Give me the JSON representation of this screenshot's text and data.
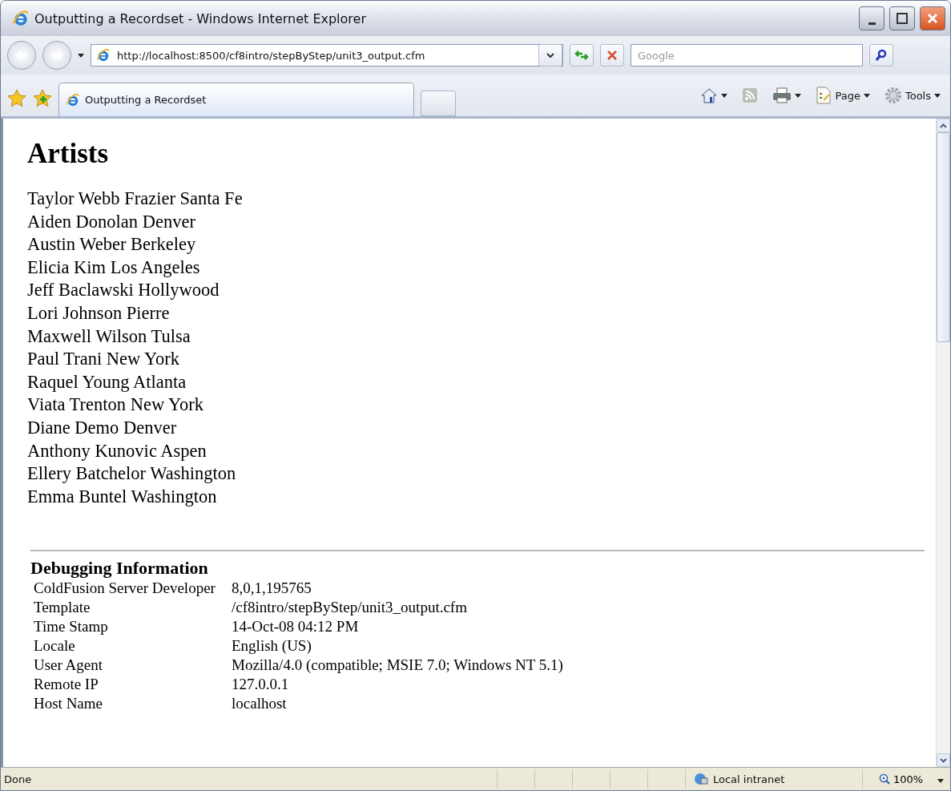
{
  "window": {
    "title": "Outputting a Recordset - Windows Internet Explorer"
  },
  "address_bar": {
    "value": "http://localhost:8500/cf8intro/stepByStep/unit3_output.cfm"
  },
  "search": {
    "placeholder": "Google"
  },
  "tabs": [
    {
      "label": "Outputting a Recordset",
      "selected": true
    }
  ],
  "command_bar": [
    {
      "kind": "home"
    },
    {
      "kind": "feeds"
    },
    {
      "kind": "print"
    },
    {
      "kind": "page",
      "label": "Page"
    },
    {
      "kind": "tools",
      "label": "Tools"
    }
  ],
  "page": {
    "heading": "Artists",
    "artists": [
      "Taylor Webb Frazier Santa Fe",
      "Aiden Donolan Denver",
      "Austin Weber Berkeley",
      "Elicia Kim Los Angeles",
      "Jeff Baclawski Hollywood",
      "Lori Johnson Pierre",
      "Maxwell Wilson Tulsa",
      "Paul Trani New York",
      "Raquel Young Atlanta",
      "Viata Trenton New York",
      "Diane Demo Denver",
      "Anthony Kunovic Aspen",
      "Ellery Batchelor Washington",
      "Emma Buntel Washington"
    ],
    "debug": {
      "title": "Debugging Information",
      "rows": [
        {
          "label": "ColdFusion Server Developer",
          "value": "8,0,1,195765"
        },
        {
          "label": "Template",
          "value": "/cf8intro/stepByStep/unit3_output.cfm"
        },
        {
          "label": "Time Stamp",
          "value": "14-Oct-08 04:12 PM"
        },
        {
          "label": "Locale",
          "value": "English (US)"
        },
        {
          "label": "User Agent",
          "value": "Mozilla/4.0 (compatible; MSIE 7.0; Windows NT 5.1)"
        },
        {
          "label": "Remote IP",
          "value": "127.0.0.1"
        },
        {
          "label": "Host Name",
          "value": "localhost"
        }
      ]
    }
  },
  "status_bar": {
    "status": "Done",
    "zone": "Local intranet",
    "zoom": "100%"
  }
}
